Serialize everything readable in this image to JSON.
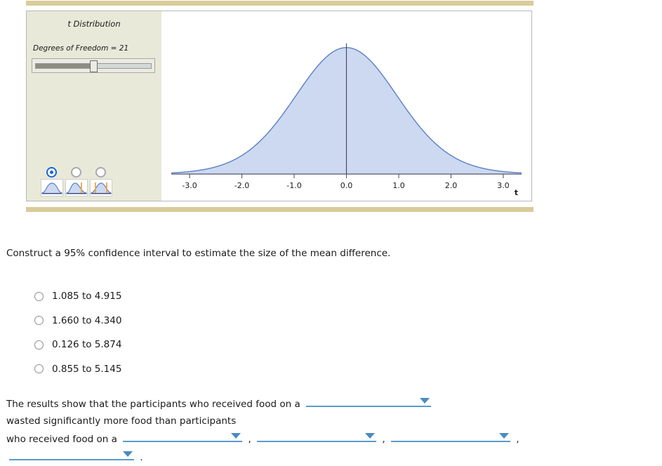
{
  "applet": {
    "title": "t Distribution",
    "df_label": "Degrees of Freedom = 21",
    "df_value": 21,
    "slider_percent": 50,
    "selected_tail_mode": 0,
    "tail_modes": [
      {
        "name": "no-tails-icon",
        "label": "two-tailed none"
      },
      {
        "name": "one-tail-icon",
        "label": "one tail"
      },
      {
        "name": "two-tail-icon",
        "label": "two tails"
      }
    ]
  },
  "chart_data": {
    "type": "line",
    "title": "t Distribution",
    "xlabel": "t",
    "ylabel": "",
    "xlim": [
      -3.35,
      3.35
    ],
    "ylim": [
      0,
      0.42
    ],
    "xticks": [
      "-3.0",
      "-2.0",
      "-1.0",
      "0.0",
      "1.0",
      "2.0",
      "3.0"
    ],
    "xtick_values": [
      -3.0,
      -2.0,
      -1.0,
      0.0,
      1.0,
      2.0,
      3.0
    ],
    "grid": false,
    "legend": "none",
    "curve_color": "#5b7fc7",
    "fill_color": "#ccd9f0",
    "center_line_at": 0.0,
    "x": [
      -3.3,
      -3.0,
      -2.7,
      -2.4,
      -2.1,
      -1.8,
      -1.5,
      -1.2,
      -0.9,
      -0.6,
      -0.3,
      0.0,
      0.3,
      0.6,
      0.9,
      1.2,
      1.5,
      1.8,
      2.1,
      2.4,
      2.7,
      3.0,
      3.3
    ],
    "y": [
      0.0041,
      0.0078,
      0.0142,
      0.0248,
      0.0414,
      0.0662,
      0.1011,
      0.1466,
      0.2008,
      0.2589,
      0.3117,
      0.3497,
      0.3117,
      0.2589,
      0.2008,
      0.1466,
      0.1011,
      0.0662,
      0.0414,
      0.0248,
      0.0142,
      0.0078,
      0.0041
    ]
  },
  "question": {
    "prompt": "Construct a 95% confidence interval to estimate the size of the mean difference.",
    "choices": [
      "1.085 to 4.915",
      "1.660 to 4.340",
      "0.126 to 5.874",
      "0.855 to 5.145"
    ]
  },
  "conclusion": {
    "frag_1": "The results show that the participants who received food on a",
    "frag_2": "wasted significantly more food than participants",
    "frag_3": "who received food on a",
    "comma_1": ",",
    "comma_2": ",",
    "comma_3": ",",
    "period": ".",
    "dropdowns": [
      {
        "name": "dropdown-plate-type-1",
        "value": ""
      },
      {
        "name": "dropdown-plate-type-2",
        "value": ""
      },
      {
        "name": "dropdown-plate-type-3",
        "value": ""
      },
      {
        "name": "dropdown-plate-type-4",
        "value": ""
      },
      {
        "name": "dropdown-plate-type-5",
        "value": ""
      }
    ]
  },
  "colors": {
    "accent_bar": "#d9cb9a",
    "panel_bg": "#e8e9d8",
    "curve_stroke": "#5b7fc7",
    "curve_fill": "#ccd9f0",
    "dropdown_line": "#5b9bd0",
    "radio_selected": "#1667d6"
  }
}
